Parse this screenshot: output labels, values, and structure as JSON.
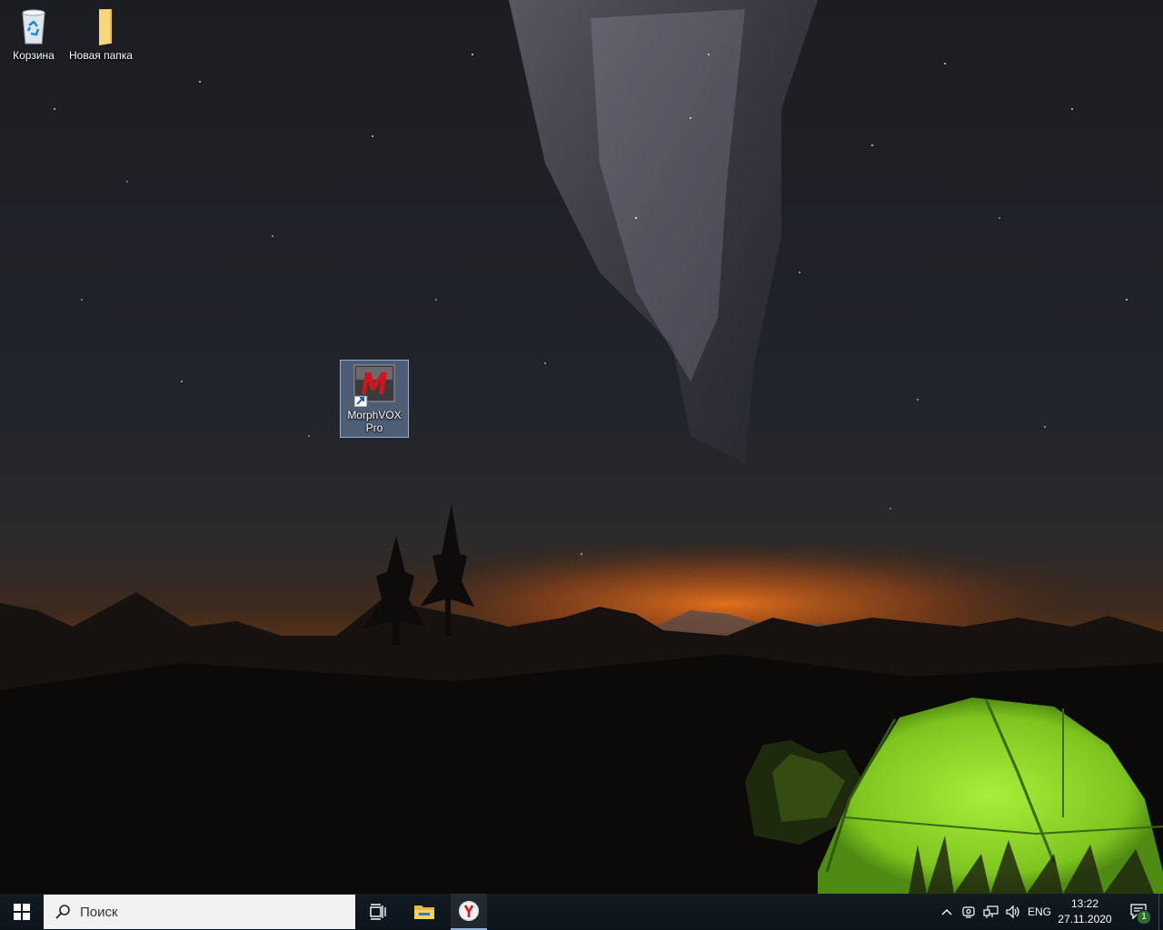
{
  "desktop": {
    "icons": [
      {
        "label": "Корзина",
        "icon": "recycle-bin-icon"
      },
      {
        "label": "Новая папка",
        "icon": "folder-icon"
      },
      {
        "label": "MorphVOX Pro",
        "icon": "morphvox-icon",
        "selected": true
      }
    ]
  },
  "taskbar": {
    "search_placeholder": "Поиск",
    "pinned": [
      {
        "name": "task-view",
        "icon": "task-view-icon"
      },
      {
        "name": "file-explorer",
        "icon": "folder-icon"
      },
      {
        "name": "yandex-browser",
        "icon": "yandex-icon",
        "active": true
      }
    ],
    "tray": {
      "language": "ENG",
      "time": "13:22",
      "date": "27.11.2020",
      "notification_count": "1"
    }
  },
  "colors": {
    "taskbar": "#101820",
    "search_bg": "#f2f2f2",
    "accent": "#8fb0d8",
    "tent": "#8ed12a"
  }
}
